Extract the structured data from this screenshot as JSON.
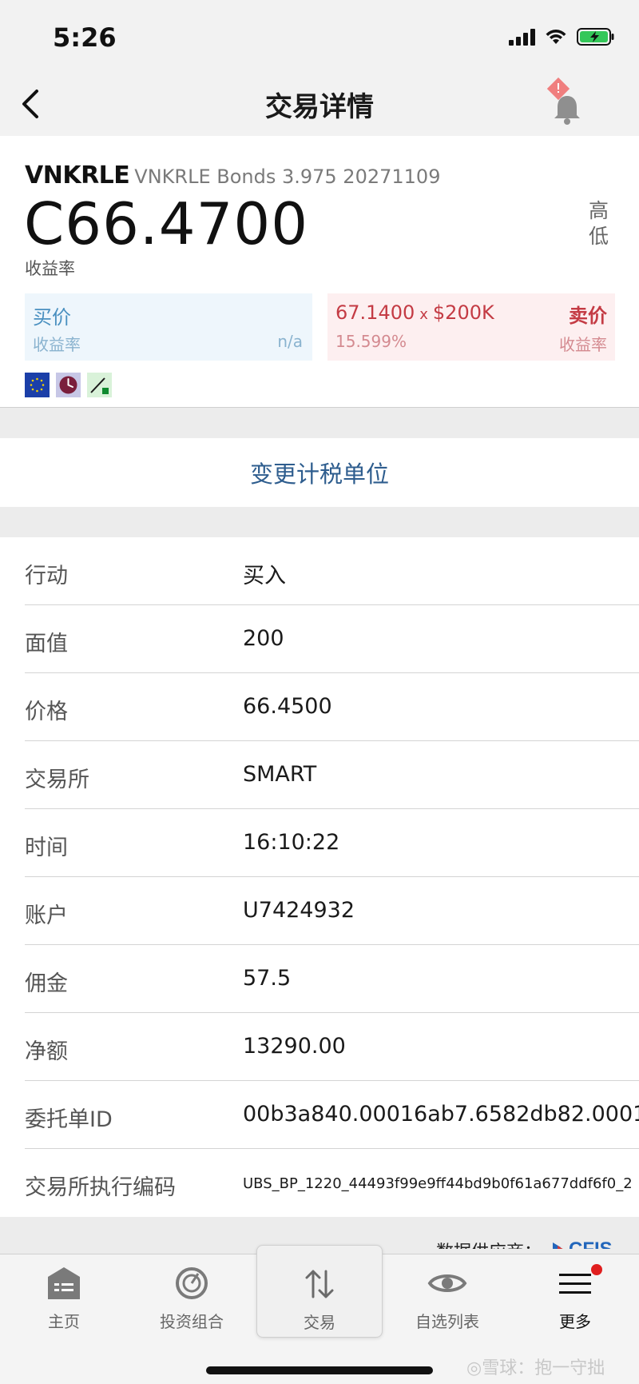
{
  "status": {
    "time": "5:26"
  },
  "nav": {
    "title": "交易详情"
  },
  "quote": {
    "symbol": "VNKRLE",
    "description": "VNKRLE Bonds 3.975 20271109",
    "price": "C66.4700",
    "price_sub": "收益率",
    "high_label": "高",
    "low_label": "低",
    "bid": {
      "label": "买价",
      "sub_label": "收益率",
      "yield": "n/a"
    },
    "ask": {
      "price": "67.1400",
      "x": "x",
      "size": "$200K",
      "label": "卖价",
      "yield": "15.599%",
      "sub_label": "收益率"
    },
    "badges": [
      "eu-flag-icon",
      "clock-icon",
      "chart-icon"
    ]
  },
  "tax_button": "变更计税单位",
  "details": [
    {
      "key": "行动",
      "value": "买入"
    },
    {
      "key": "面值",
      "value": "200"
    },
    {
      "key": "价格",
      "value": "66.4500"
    },
    {
      "key": "交易所",
      "value": "SMART"
    },
    {
      "key": "时间",
      "value": "16:10:22"
    },
    {
      "key": "账户",
      "value": "U7424932"
    },
    {
      "key": "佣金",
      "value": "57.5"
    },
    {
      "key": "净额",
      "value": "13290.00"
    },
    {
      "key": "委托单ID",
      "value": "00b3a840.00016ab7.6582db82.0001"
    },
    {
      "key": "交易所执行编码",
      "value": "UBS_BP_1220_44493f99e9ff44bd9b0f61a677ddf6f0_2"
    }
  ],
  "provider": {
    "label": "数据供应商：",
    "logo": "CFIS"
  },
  "tabs": [
    {
      "label": "主页",
      "icon": "home-icon"
    },
    {
      "label": "投资组合",
      "icon": "portfolio-icon"
    },
    {
      "label": "交易",
      "icon": "trade-icon"
    },
    {
      "label": "自选列表",
      "icon": "eye-icon"
    },
    {
      "label": "更多",
      "icon": "menu-icon"
    }
  ],
  "watermark": "◎雪球：抱一守拙",
  "colors": {
    "bid": "#4a90c0",
    "ask": "#c43b44",
    "accent": "#2e5d8e"
  }
}
